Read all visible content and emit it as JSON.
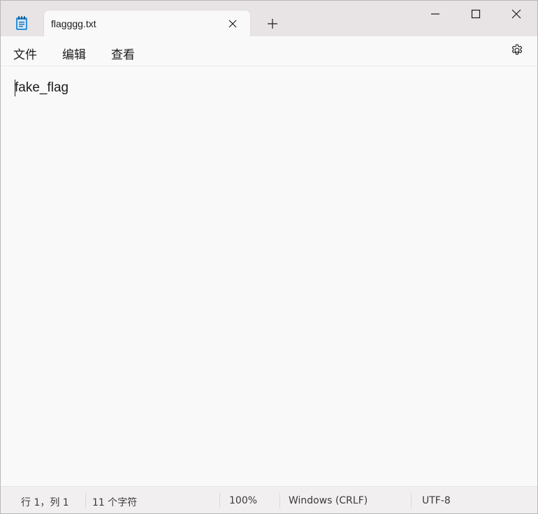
{
  "titlebar": {
    "app_icon": "notepad-icon",
    "tab": {
      "title": "flagggg.txt",
      "close_icon": "close-icon"
    },
    "new_tab_icon": "plus-icon",
    "window_controls": {
      "minimize_icon": "minimize-icon",
      "maximize_icon": "maximize-icon",
      "close_icon": "close-icon"
    }
  },
  "menubar": {
    "items": [
      "文件",
      "编辑",
      "查看"
    ],
    "settings_icon": "gear-icon"
  },
  "editor": {
    "content": "fake_flag"
  },
  "statusbar": {
    "position": "行 1，列 1",
    "char_count": "11 个字符",
    "zoom": "100%",
    "line_ending": "Windows (CRLF)",
    "encoding": "UTF-8"
  },
  "colors": {
    "titlebar_bg": "#e8e4e6",
    "editor_bg": "#f9f9f9",
    "statusbar_bg": "#f2eff0",
    "text": "#1b1b1b",
    "app_icon_blue": "#2f8fd6"
  }
}
